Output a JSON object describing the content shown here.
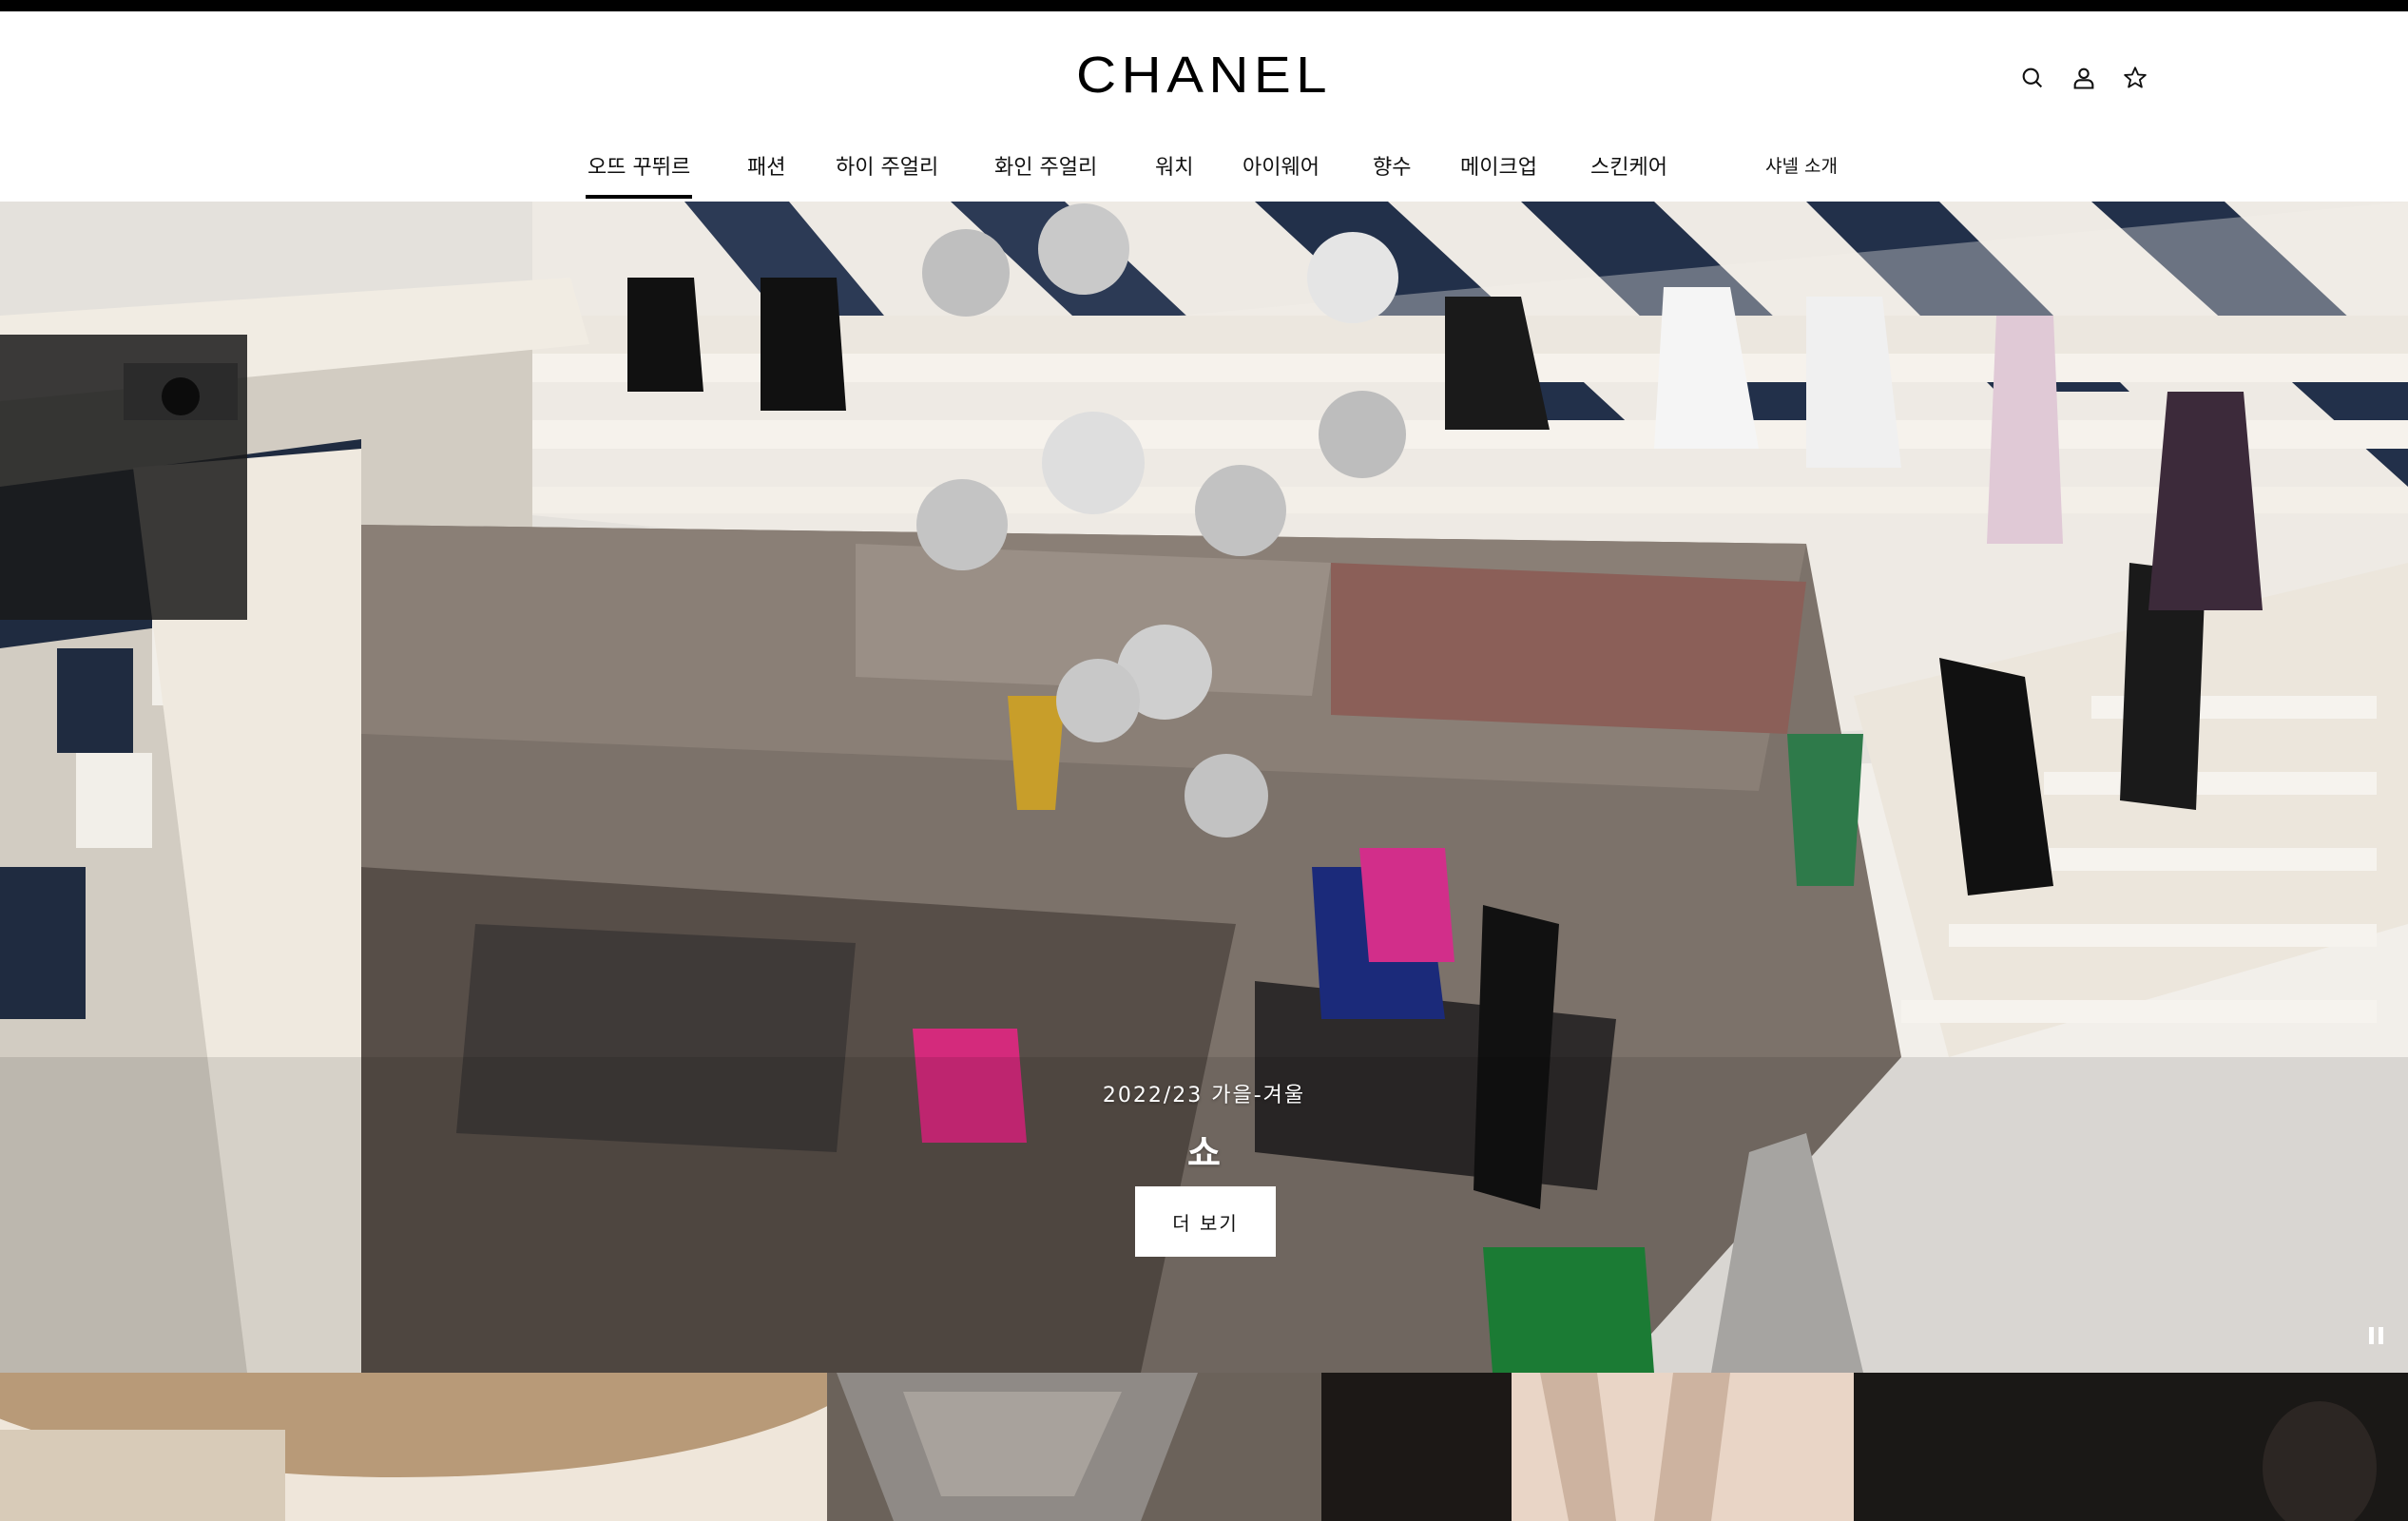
{
  "brand": {
    "logo": "CHANEL"
  },
  "utilities": [
    {
      "name": "search-icon"
    },
    {
      "name": "user-icon"
    },
    {
      "name": "wishlist-star-icon"
    }
  ],
  "nav": {
    "items": [
      "오뜨 꾸뛰르",
      "패션",
      "하이 주얼리",
      "화인 주얼리",
      "워치",
      "아이웨어",
      "향수",
      "메이크업",
      "스킨케어"
    ],
    "about": "샤넬 소개",
    "active_index": 0
  },
  "hero": {
    "eyebrow": "2022/23 가을-겨울",
    "title": "쇼",
    "cta": "더 보기"
  },
  "colors": {
    "black": "#000000",
    "white": "#ffffff"
  }
}
